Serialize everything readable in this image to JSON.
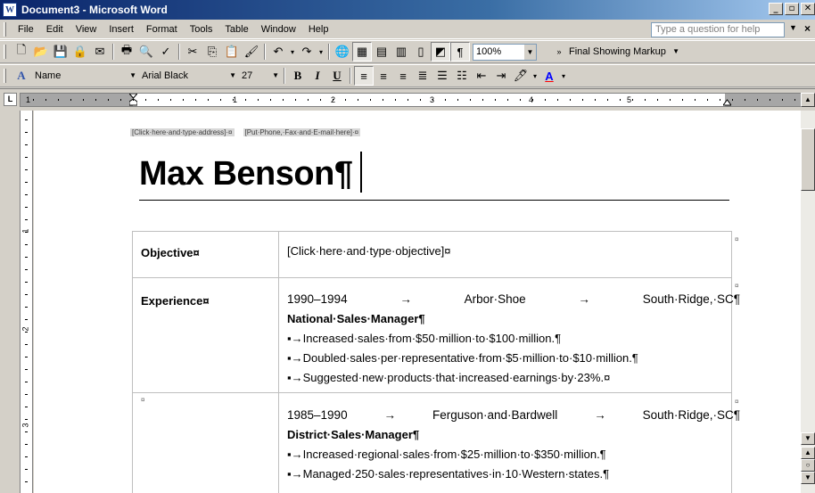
{
  "window": {
    "app_icon": "W",
    "title": "Document3 - Microsoft Word",
    "buttons": [
      "_",
      "▫",
      "✕"
    ]
  },
  "menu": {
    "items": [
      "File",
      "Edit",
      "View",
      "Insert",
      "Format",
      "Tools",
      "Table",
      "Window",
      "Help"
    ],
    "help_placeholder": "Type a question for help",
    "close_doc": "×"
  },
  "toolbar_standard": {
    "zoom": "100%",
    "markup_mode": "Final Showing Markup",
    "icons": [
      "new-icon",
      "open-icon",
      "save-icon",
      "permission-icon",
      "email-icon",
      "print-icon",
      "print-preview-icon",
      "spelling-icon",
      "cut-icon",
      "copy-icon",
      "paste-icon",
      "format-painter-icon",
      "undo-icon",
      "redo-icon",
      "hyperlink-icon",
      "tables-borders-icon",
      "insert-table-icon",
      "insert-excel-icon",
      "columns-icon",
      "drawing-icon",
      "show-formatting-icon"
    ]
  },
  "toolbar_formatting": {
    "style": "Name",
    "font": "Arial Black",
    "size": "27",
    "bold": "B",
    "italic": "I",
    "underline": "U",
    "highlight": "🖊",
    "font_color": "A"
  },
  "ruler": {
    "tab_selector": "L",
    "numbers": [
      "1",
      "1",
      "2",
      "3",
      "4",
      "5"
    ]
  },
  "vruler_numbers": [
    "1",
    "2",
    "3"
  ],
  "document": {
    "address_placeholder": "[Click·here·and·type·address]·¤",
    "contact_placeholder": "[Put·Phone,·Fax·and·E-mail·here]·¤",
    "name": "Max Benson¶",
    "sections": [
      {
        "label": "Objective¤",
        "lines": [
          "[Click·here·and·type·objective]¤"
        ]
      },
      {
        "label": "Experience¤",
        "job": {
          "dates": "1990–1994",
          "arrow1": "→",
          "company": "Arbor·Shoe",
          "arrow2": "→",
          "location": "South·Ridge,·SC¶",
          "title": "National·Sales·Manager¶",
          "bullets": [
            "▪→Increased·sales·from·$50·million·to·$100·million.¶",
            "▪→Doubled·sales·per·representative·from·$5·million·to·$10·million.¶",
            "▪→Suggested·new·products·that·increased·earnings·by·23%.¤"
          ]
        }
      },
      {
        "label": "¤",
        "job": {
          "dates": "1985–1990",
          "arrow1": "→",
          "company": "Ferguson·and·Bardwell",
          "arrow2": "→",
          "location": "South·Ridge,·SC¶",
          "title": "District·Sales·Manager¶",
          "bullets": [
            "▪→Increased·regional·sales·from·$25·million·to·$350·million.¶",
            "▪→Managed·250·sales·representatives·in·10·Western·states.¶"
          ]
        }
      }
    ],
    "cell_mark": "¤"
  }
}
